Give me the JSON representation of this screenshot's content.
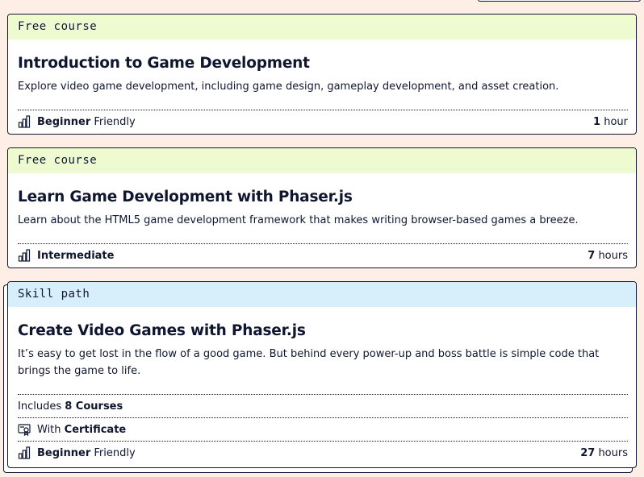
{
  "cards": [
    {
      "badge": "Free course",
      "title": "Introduction to Game Development",
      "description": "Explore video game development, including game design, gameplay development, and asset creation.",
      "level_bold": "Beginner",
      "level_rest": " Friendly",
      "duration_bold": "1",
      "duration_rest": " hour"
    },
    {
      "badge": "Free course",
      "title": "Learn Game Development with Phaser.js",
      "description": "Learn about the HTML5 game development framework that makes writing browser-based games a breeze.",
      "level_bold": "Intermediate",
      "level_rest": "",
      "duration_bold": "7",
      "duration_rest": " hours"
    },
    {
      "badge": "Skill path",
      "title": "Create Video Games with Phaser.js",
      "description": "It’s easy to get lost in the flow of a good game. But behind every power-up and boss battle is simple code that brings the game to life.",
      "includes_prefix": "Includes ",
      "includes_bold": "8 Courses",
      "certificate_prefix": "With ",
      "certificate_bold": "Certificate",
      "level_bold": "Beginner",
      "level_rest": " Friendly",
      "duration_bold": "27",
      "duration_rest": " hours"
    }
  ],
  "icons": {
    "level": "bar-chart-icon",
    "certificate": "certificate-icon"
  },
  "colors": {
    "page_bg": "#fdeee6",
    "free_badge_bg": "#eefbd0",
    "path_badge_bg": "#d6effb",
    "text": "#10162f"
  }
}
